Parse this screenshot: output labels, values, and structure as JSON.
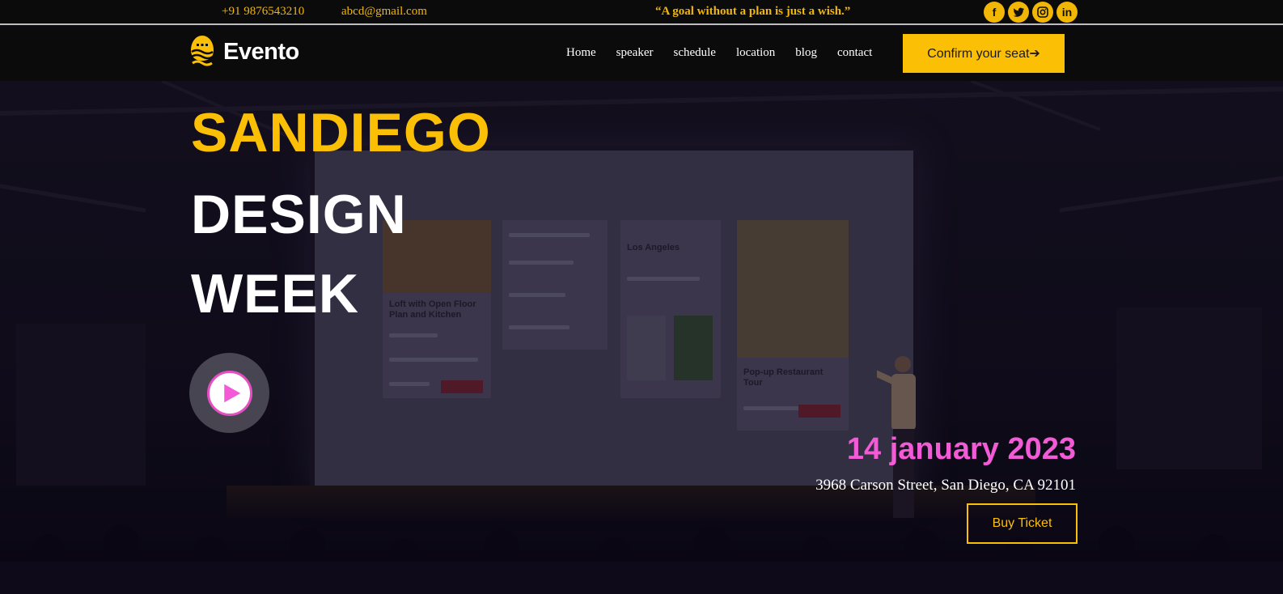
{
  "topbar": {
    "phone": "+91 9876543210",
    "email": "abcd@gmail.com",
    "quote": "“A goal without a plan is just a wish.”",
    "socials": [
      {
        "icon": "facebook-icon",
        "glyph": "f"
      },
      {
        "icon": "twitter-icon",
        "glyph": ""
      },
      {
        "icon": "instagram-icon",
        "glyph": ""
      },
      {
        "icon": "linkedin-icon",
        "glyph": "in"
      }
    ]
  },
  "nav": {
    "logo_text": "Evento",
    "menu": [
      "Home",
      "speaker",
      "schedule",
      "location",
      "blog",
      "contact"
    ],
    "confirm_label": "Confirm your seat➔"
  },
  "hero": {
    "line1": "SANDIEGO",
    "line2": "DESIGN",
    "line3": "WEEK",
    "date": "14 january 2023",
    "address": "3968 Carson Street, San Diego, CA 92101",
    "buy_label": "Buy Ticket"
  },
  "colors": {
    "accent": "#fbbf05",
    "pink": "#f25ad6",
    "bar_bg": "#0b0b0b"
  }
}
